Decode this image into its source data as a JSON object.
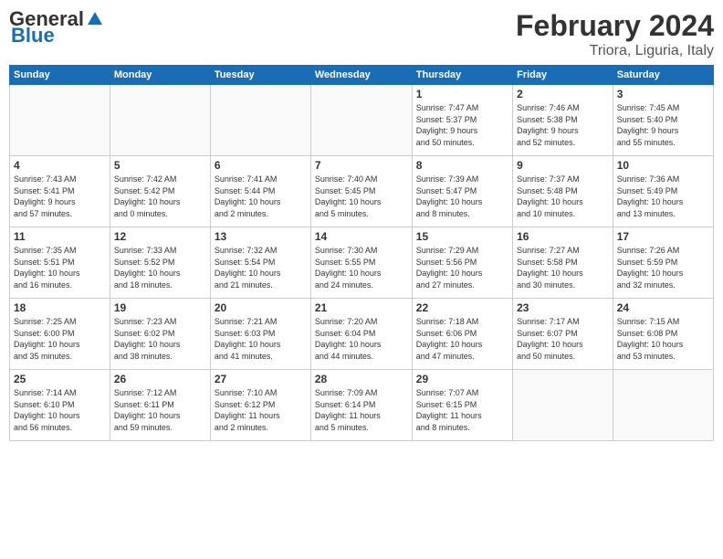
{
  "header": {
    "logo_general": "General",
    "logo_blue": "Blue",
    "month_title": "February 2024",
    "location": "Triora, Liguria, Italy"
  },
  "days_of_week": [
    "Sunday",
    "Monday",
    "Tuesday",
    "Wednesday",
    "Thursday",
    "Friday",
    "Saturday"
  ],
  "weeks": [
    [
      {
        "day": "",
        "info": ""
      },
      {
        "day": "",
        "info": ""
      },
      {
        "day": "",
        "info": ""
      },
      {
        "day": "",
        "info": ""
      },
      {
        "day": "1",
        "info": "Sunrise: 7:47 AM\nSunset: 5:37 PM\nDaylight: 9 hours\nand 50 minutes."
      },
      {
        "day": "2",
        "info": "Sunrise: 7:46 AM\nSunset: 5:38 PM\nDaylight: 9 hours\nand 52 minutes."
      },
      {
        "day": "3",
        "info": "Sunrise: 7:45 AM\nSunset: 5:40 PM\nDaylight: 9 hours\nand 55 minutes."
      }
    ],
    [
      {
        "day": "4",
        "info": "Sunrise: 7:43 AM\nSunset: 5:41 PM\nDaylight: 9 hours\nand 57 minutes."
      },
      {
        "day": "5",
        "info": "Sunrise: 7:42 AM\nSunset: 5:42 PM\nDaylight: 10 hours\nand 0 minutes."
      },
      {
        "day": "6",
        "info": "Sunrise: 7:41 AM\nSunset: 5:44 PM\nDaylight: 10 hours\nand 2 minutes."
      },
      {
        "day": "7",
        "info": "Sunrise: 7:40 AM\nSunset: 5:45 PM\nDaylight: 10 hours\nand 5 minutes."
      },
      {
        "day": "8",
        "info": "Sunrise: 7:39 AM\nSunset: 5:47 PM\nDaylight: 10 hours\nand 8 minutes."
      },
      {
        "day": "9",
        "info": "Sunrise: 7:37 AM\nSunset: 5:48 PM\nDaylight: 10 hours\nand 10 minutes."
      },
      {
        "day": "10",
        "info": "Sunrise: 7:36 AM\nSunset: 5:49 PM\nDaylight: 10 hours\nand 13 minutes."
      }
    ],
    [
      {
        "day": "11",
        "info": "Sunrise: 7:35 AM\nSunset: 5:51 PM\nDaylight: 10 hours\nand 16 minutes."
      },
      {
        "day": "12",
        "info": "Sunrise: 7:33 AM\nSunset: 5:52 PM\nDaylight: 10 hours\nand 18 minutes."
      },
      {
        "day": "13",
        "info": "Sunrise: 7:32 AM\nSunset: 5:54 PM\nDaylight: 10 hours\nand 21 minutes."
      },
      {
        "day": "14",
        "info": "Sunrise: 7:30 AM\nSunset: 5:55 PM\nDaylight: 10 hours\nand 24 minutes."
      },
      {
        "day": "15",
        "info": "Sunrise: 7:29 AM\nSunset: 5:56 PM\nDaylight: 10 hours\nand 27 minutes."
      },
      {
        "day": "16",
        "info": "Sunrise: 7:27 AM\nSunset: 5:58 PM\nDaylight: 10 hours\nand 30 minutes."
      },
      {
        "day": "17",
        "info": "Sunrise: 7:26 AM\nSunset: 5:59 PM\nDaylight: 10 hours\nand 32 minutes."
      }
    ],
    [
      {
        "day": "18",
        "info": "Sunrise: 7:25 AM\nSunset: 6:00 PM\nDaylight: 10 hours\nand 35 minutes."
      },
      {
        "day": "19",
        "info": "Sunrise: 7:23 AM\nSunset: 6:02 PM\nDaylight: 10 hours\nand 38 minutes."
      },
      {
        "day": "20",
        "info": "Sunrise: 7:21 AM\nSunset: 6:03 PM\nDaylight: 10 hours\nand 41 minutes."
      },
      {
        "day": "21",
        "info": "Sunrise: 7:20 AM\nSunset: 6:04 PM\nDaylight: 10 hours\nand 44 minutes."
      },
      {
        "day": "22",
        "info": "Sunrise: 7:18 AM\nSunset: 6:06 PM\nDaylight: 10 hours\nand 47 minutes."
      },
      {
        "day": "23",
        "info": "Sunrise: 7:17 AM\nSunset: 6:07 PM\nDaylight: 10 hours\nand 50 minutes."
      },
      {
        "day": "24",
        "info": "Sunrise: 7:15 AM\nSunset: 6:08 PM\nDaylight: 10 hours\nand 53 minutes."
      }
    ],
    [
      {
        "day": "25",
        "info": "Sunrise: 7:14 AM\nSunset: 6:10 PM\nDaylight: 10 hours\nand 56 minutes."
      },
      {
        "day": "26",
        "info": "Sunrise: 7:12 AM\nSunset: 6:11 PM\nDaylight: 10 hours\nand 59 minutes."
      },
      {
        "day": "27",
        "info": "Sunrise: 7:10 AM\nSunset: 6:12 PM\nDaylight: 11 hours\nand 2 minutes."
      },
      {
        "day": "28",
        "info": "Sunrise: 7:09 AM\nSunset: 6:14 PM\nDaylight: 11 hours\nand 5 minutes."
      },
      {
        "day": "29",
        "info": "Sunrise: 7:07 AM\nSunset: 6:15 PM\nDaylight: 11 hours\nand 8 minutes."
      },
      {
        "day": "",
        "info": ""
      },
      {
        "day": "",
        "info": ""
      }
    ]
  ]
}
